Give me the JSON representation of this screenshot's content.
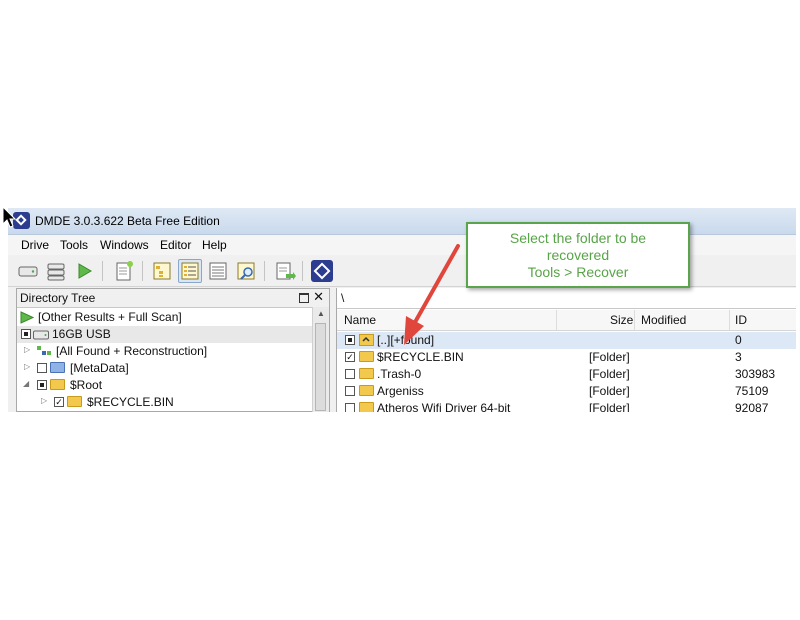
{
  "window": {
    "title": "DMDE 3.0.3.622 Beta Free Edition"
  },
  "menu": [
    "Drive",
    "Tools",
    "Windows",
    "Editor",
    "Help"
  ],
  "toolbar": {
    "buttons": [
      "drive-icon",
      "partitions-icon",
      "play-icon",
      "new-file-icon",
      "tree-view-icon",
      "list-view-icon",
      "details-view-icon",
      "search-view-icon",
      "export-icon",
      "dmde-logo-icon"
    ]
  },
  "directory_tree": {
    "title": "Directory Tree",
    "items": [
      {
        "label": "[Other Results + Full Scan]"
      },
      {
        "label": "16GB USB"
      },
      {
        "label": "[All Found + Reconstruction]"
      },
      {
        "label": "[MetaData]"
      },
      {
        "label": "$Root"
      },
      {
        "label": "$RECYCLE.BIN"
      }
    ]
  },
  "file_list": {
    "path": "\\",
    "columns": {
      "name": "Name",
      "size": "Size",
      "modified": "Modified",
      "id": "ID"
    },
    "rows": [
      {
        "name": "[..][+found]",
        "size": "",
        "modified": "",
        "id": "0"
      },
      {
        "name": "$RECYCLE.BIN",
        "size": "[Folder]",
        "modified": "",
        "id": "3"
      },
      {
        "name": ".Trash-0",
        "size": "[Folder]",
        "modified": "",
        "id": "303983"
      },
      {
        "name": "Argeniss",
        "size": "[Folder]",
        "modified": "",
        "id": "75109"
      },
      {
        "name": "Atheros Wifi Driver 64-bit",
        "size": "[Folder]",
        "modified": "",
        "id": "92087"
      }
    ]
  },
  "callout": {
    "line1": "Select the folder to be",
    "line2": "recovered",
    "line3": "Tools > Recover"
  },
  "colors": {
    "callout_green": "#58a448",
    "arrow_red": "#e0463c",
    "accent": "#2c3d8f"
  }
}
